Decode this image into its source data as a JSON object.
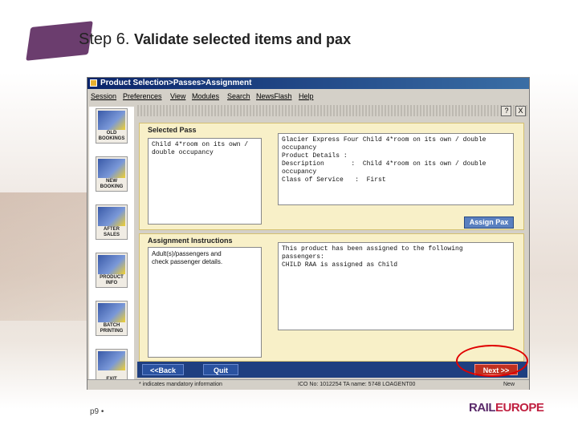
{
  "slide": {
    "step_label": "Step 6.",
    "title_rest": "Validate selected items and pax",
    "page_number": "p9",
    "page_suffix": "•",
    "brand_left": "RAIL",
    "brand_right": "EUROPE"
  },
  "window": {
    "title": "Product Selection>Passes>Assignment",
    "menu": [
      "Session",
      "Preferences",
      "View",
      "Modules",
      "Search",
      "NewsFlash",
      "Help"
    ],
    "controls": [
      "?",
      "X"
    ]
  },
  "sidebar": {
    "buttons": [
      {
        "label": "OLD BOOKINGS",
        "icon": "old-bookings-icon"
      },
      {
        "label": "NEW BOOKING",
        "icon": "new-booking-icon"
      },
      {
        "label": "AFTER SALES",
        "icon": "after-sales-icon"
      },
      {
        "label": "PRODUCT INFO",
        "icon": "product-info-icon"
      },
      {
        "label": "BATCH PRINTING",
        "icon": "batch-printing-icon"
      },
      {
        "label": "EXIT",
        "icon": "exit-icon"
      }
    ]
  },
  "selected_pass": {
    "heading": "Selected Pass",
    "list_text": "Child 4*room on its own /\ndouble occupancy",
    "details_text": "Glacier Express Four Child 4*room on its own / double\noccupancy\nProduct Details :\nDescription       :  Child 4*room on its own / double\noccupancy\nClass of Service   :  First",
    "assign_button": "Assign Pax"
  },
  "assignment": {
    "heading": "Assignment Instructions",
    "instructions_text": "Adult(s)/passengers and\ncheck passenger details.",
    "result_text": "This product has been assigned to the following\npassengers:\nCHILD RAA is assigned as Child"
  },
  "actions": {
    "back": "<<Back",
    "quit": "Quit",
    "next": "Next >>"
  },
  "status": {
    "left": "* indicates mandatory information",
    "middle": "ICO No: 1012254   TA name: 5748 LOAGENT00",
    "right": "New"
  }
}
